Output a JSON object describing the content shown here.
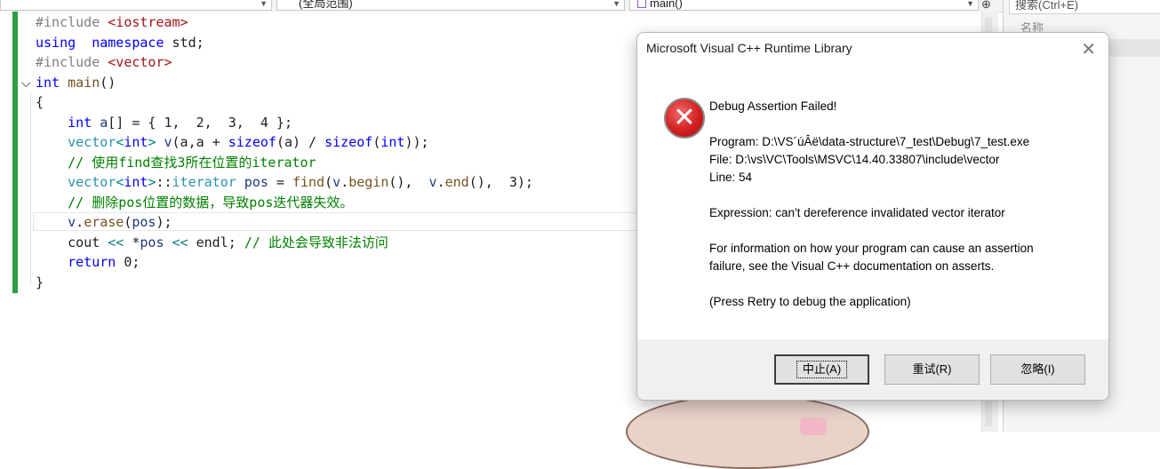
{
  "navbar": {
    "project_scope": "",
    "scope": "(全局范围)",
    "member": "main()"
  },
  "search_pane": {
    "placeholder": "搜索(Ctrl+E)",
    "column_header": "名称"
  },
  "code": [
    {
      "tokens": [
        [
          "pp",
          "#include "
        ],
        [
          "inc",
          "<iostream>"
        ]
      ]
    },
    {
      "tokens": [
        [
          "kw",
          "using"
        ],
        [
          "",
          "  "
        ],
        [
          "kw",
          "namespace"
        ],
        [
          "",
          " std;"
        ]
      ]
    },
    {
      "tokens": [
        [
          "pp",
          "#include "
        ],
        [
          "inc",
          "<vector>"
        ]
      ]
    },
    {
      "tokens": [
        [
          "kw",
          "int"
        ],
        [
          "",
          ""
        ],
        [
          "fn",
          " main"
        ],
        [
          "",
          "()"
        ]
      ]
    },
    {
      "tokens": [
        [
          "",
          "{"
        ]
      ]
    },
    {
      "tokens": [
        [
          "",
          "    "
        ],
        [
          "kw",
          "int"
        ],
        [
          "",
          ""
        ],
        [
          "var",
          " a"
        ],
        [
          "",
          "[] = { 1,  2,  3,  4 };"
        ]
      ]
    },
    {
      "tokens": [
        [
          "",
          "    "
        ],
        [
          "ty",
          "vector"
        ],
        [
          "op",
          "<"
        ],
        [
          "kw",
          "int"
        ],
        [
          "op",
          ">"
        ],
        [
          "var",
          " v"
        ],
        [
          "",
          "(a,a + "
        ],
        [
          "kw",
          "sizeof"
        ],
        [
          "",
          "(a) / "
        ],
        [
          "kw",
          "sizeof"
        ],
        [
          "",
          "("
        ],
        [
          "kw",
          "int"
        ],
        [
          "",
          "));"
        ]
      ]
    },
    {
      "tokens": [
        [
          "",
          "    "
        ],
        [
          "cm",
          "// 使用find查找3所在位置的iterator"
        ]
      ]
    },
    {
      "tokens": [
        [
          "",
          "    "
        ],
        [
          "ty",
          "vector"
        ],
        [
          "op",
          "<"
        ],
        [
          "kw",
          "int"
        ],
        [
          "op",
          ">"
        ],
        [
          "",
          "::"
        ],
        [
          "ty",
          "iterator"
        ],
        [
          "var",
          " pos"
        ],
        [
          "",
          " = "
        ],
        [
          "fn",
          "find"
        ],
        [
          "",
          "("
        ],
        [
          "var",
          "v"
        ],
        [
          ".",
          "."
        ],
        [
          "fn",
          "begin"
        ],
        [
          "",
          "(),  "
        ],
        [
          "var",
          "v"
        ],
        [
          ".",
          "."
        ],
        [
          "fn",
          "end"
        ],
        [
          "",
          "(),  3);"
        ]
      ]
    },
    {
      "tokens": [
        [
          "",
          "    "
        ],
        [
          "cm",
          "// 删除pos位置的数据，导致pos迭代器失效。"
        ]
      ]
    },
    {
      "tokens": [
        [
          "",
          "    "
        ],
        [
          "var",
          "v"
        ],
        [
          ".",
          "."
        ],
        [
          "fn",
          "erase"
        ],
        [
          "",
          "("
        ],
        [
          "var",
          "pos"
        ],
        [
          "",
          ");"
        ]
      ]
    },
    {
      "tokens": [
        [
          "",
          "    cout "
        ],
        [
          "op",
          "<<"
        ],
        [
          "",
          " *"
        ],
        [
          "var",
          "pos"
        ],
        [
          "",
          " "
        ],
        [
          "op",
          "<<"
        ],
        [
          "",
          " endl; "
        ],
        [
          "cm",
          "// 此处会导致非法访问"
        ]
      ]
    },
    {
      "tokens": [
        [
          "",
          "    "
        ],
        [
          "kw",
          "return"
        ],
        [
          "",
          " 0;"
        ]
      ]
    },
    {
      "tokens": [
        [
          "",
          "}"
        ]
      ]
    }
  ],
  "dialog": {
    "title": "Microsoft Visual C++ Runtime Library",
    "close_glyph": "✕",
    "icon_glyph": "✕",
    "heading": "Debug Assertion Failed!",
    "program": "Program: D:\\VS´úÂë\\data-structure\\7_test\\Debug\\7_test.exe",
    "file": "File: D:\\vs\\VC\\Tools\\MSVC\\14.40.33807\\include\\vector",
    "line": "Line: 54",
    "expression": "Expression: can't dereference invalidated vector iterator",
    "info_1": "For information on how your program can cause an assertion",
    "info_2": "failure, see the Visual C++ documentation on asserts.",
    "hint": "(Press Retry to debug the application)",
    "buttons": {
      "abort": "中止(A)",
      "retry": "重试(R)",
      "ignore": "忽略(I)"
    }
  },
  "colors": {
    "change_bar": "#2f9e44",
    "keyword": "#0000ff",
    "comment": "#008000",
    "type": "#2b91af",
    "error_red": "#d42020"
  }
}
